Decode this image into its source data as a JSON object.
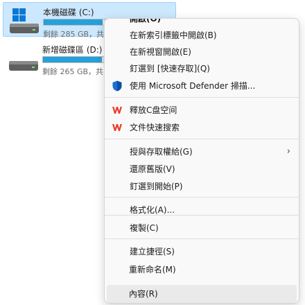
{
  "drives": [
    {
      "name": "本機磁碟 (C:)",
      "free_text": "剩餘 285 GB，共",
      "usage": 0.45,
      "selected": true
    },
    {
      "name": "新增磁碟區 (D:)",
      "free_text": "剩餘 265 GB，共",
      "usage": 0.45,
      "selected": false
    }
  ],
  "menu": {
    "open": "開啟(O)",
    "open_new_process": "在新索引標籤中開啟(B)",
    "open_new_window": "在新視窗開啟(E)",
    "pin_quick_access": "釘選到 [快速存取](Q)",
    "defender_scan": "使用 Microsoft Defender 掃描...",
    "free_c": "釋放C盘空间",
    "file_quick_search": "文件快速搜索",
    "give_access": "授與存取權給(G)",
    "restore_previous": "還原舊版(V)",
    "pin_start": "釘選到開始(P)",
    "format": "格式化(A)...",
    "copy": "複製(C)",
    "create_shortcut": "建立捷徑(S)",
    "rename": "重新命名(M)",
    "properties": "內容(R)"
  },
  "icons": {
    "defender": "shield-icon",
    "wps": "wps-logo-icon",
    "submenu": "chevron-right-icon",
    "drive": "hard-drive-icon",
    "windows": "windows-logo-icon"
  },
  "colors": {
    "accent": "#26a0da",
    "selection": "#cce8ff",
    "wps_red": "#e8412c",
    "defender_blue": "#1d6fd1"
  }
}
